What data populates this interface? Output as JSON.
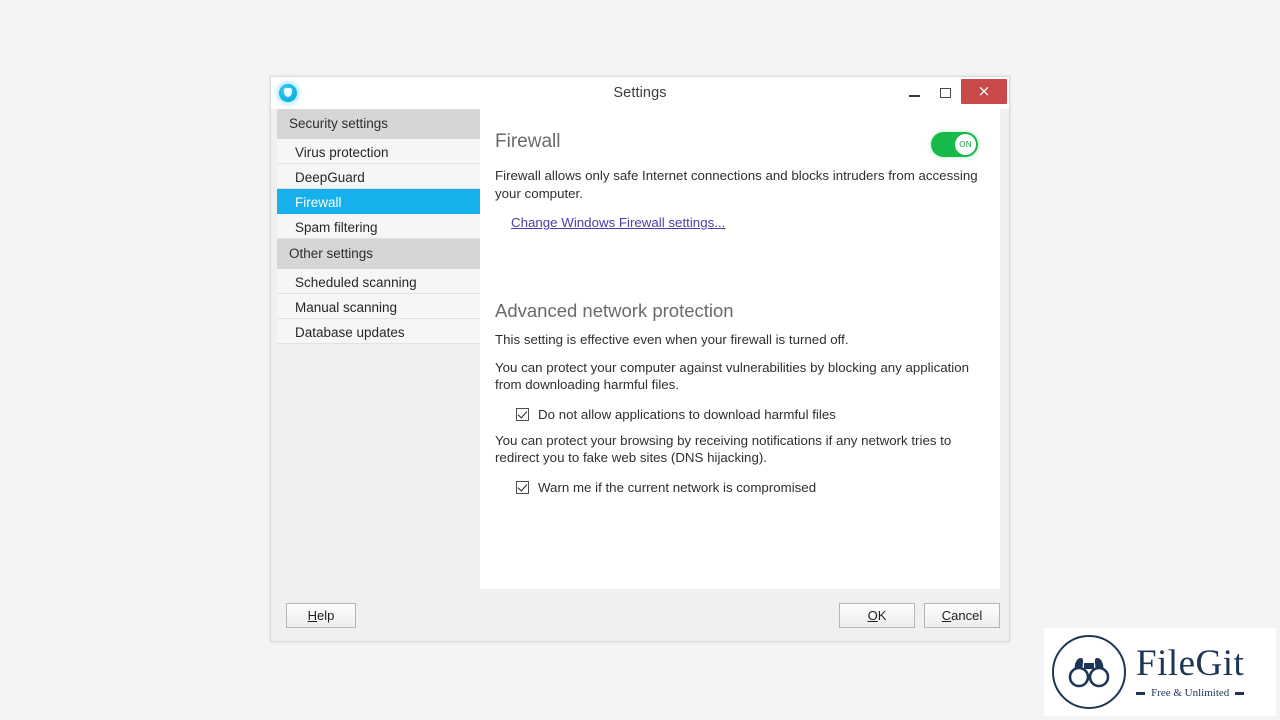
{
  "window": {
    "title": "Settings",
    "app_icon": "fsecure-shield-icon",
    "controls": {
      "minimize": "minimize-icon",
      "maximize": "maximize-icon",
      "close": "×"
    }
  },
  "sidebar": {
    "groups": [
      {
        "header": "Security settings",
        "items": [
          {
            "label": "Virus protection",
            "selected": false
          },
          {
            "label": "DeepGuard",
            "selected": false
          },
          {
            "label": "Firewall",
            "selected": true
          },
          {
            "label": "Spam filtering",
            "selected": false
          }
        ]
      },
      {
        "header": "Other settings",
        "items": [
          {
            "label": "Scheduled scanning",
            "selected": false
          },
          {
            "label": "Manual scanning",
            "selected": false
          },
          {
            "label": "Database updates",
            "selected": false
          }
        ]
      }
    ]
  },
  "content": {
    "firewall": {
      "title": "Firewall",
      "description": "Firewall allows only safe Internet connections and blocks intruders from accessing your computer.",
      "link": "Change Windows Firewall settings...",
      "toggle_state": "ON"
    },
    "advanced": {
      "title": "Advanced network protection",
      "note": "This setting is effective even when your firewall is turned off.",
      "paragraph_1": "You can protect your computer against vulnerabilities by blocking any application from downloading harmful files.",
      "checkbox_1": {
        "label": "Do not allow applications to download harmful files",
        "checked": true
      },
      "paragraph_2": "You can protect your browsing by receiving notifications if any network tries to redirect you to fake web sites (DNS hijacking).",
      "checkbox_2": {
        "label": "Warn me if the current network is compromised",
        "checked": true
      }
    }
  },
  "footer": {
    "help": "Help",
    "help_accel": "H",
    "ok": "OK",
    "ok_accel": "O",
    "cancel": "Cancel",
    "cancel_accel": "C"
  },
  "watermark": {
    "name": "FileGit",
    "tagline": "Free & Unlimited",
    "logo_icon": "binoculars-icon"
  },
  "colors": {
    "accent_selected": "#16b0ec",
    "toggle_on": "#16b94a",
    "close_button": "#c94a4a",
    "link": "#4b3ea8",
    "brand_navy": "#1d3557"
  }
}
